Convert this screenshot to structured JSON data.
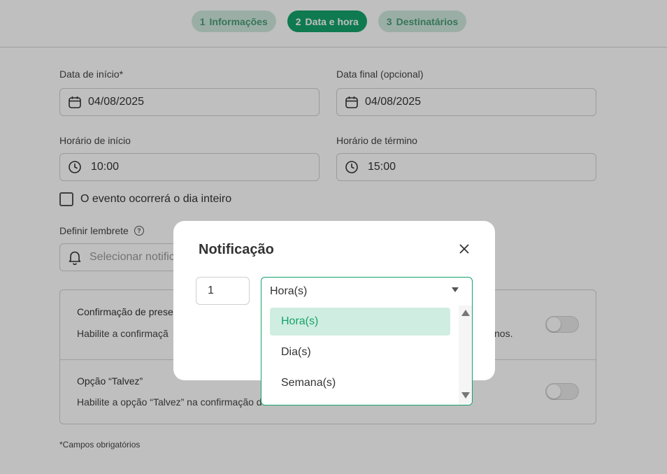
{
  "steps": [
    {
      "num": "1",
      "label": "Informações"
    },
    {
      "num": "2",
      "label": "Data e hora"
    },
    {
      "num": "3",
      "label": "Destinatários"
    }
  ],
  "form": {
    "start_date": {
      "label": "Data de início*",
      "value": "04/08/2025",
      "icon": "calendar-icon"
    },
    "end_date": {
      "label": "Data final (opcional)",
      "value": "04/08/2025",
      "icon": "calendar-icon"
    },
    "start_time": {
      "label": "Horário de início",
      "value": "10:00",
      "icon": "clock-icon"
    },
    "end_time": {
      "label": "Horário de término",
      "value": "15:00",
      "icon": "clock-icon"
    },
    "all_day": {
      "label": "O evento ocorrerá o dia inteiro",
      "checked": false
    },
    "reminder": {
      "label": "Definir lembrete",
      "placeholder": "Selecionar notific",
      "icon": "bell-icon"
    }
  },
  "options_card": {
    "confirmation": {
      "title": "Confirmação de prese",
      "description": "Habilite a confirmaçã",
      "description_tail": "nos.",
      "enabled": false
    },
    "maybe": {
      "title": "Opção “Talvez”",
      "description": "Habilite a opção “Talvez” na confirmação d",
      "enabled": false
    }
  },
  "footnote": "*Campos obrigatórios",
  "modal": {
    "title": "Notificação",
    "quantity": "1",
    "unit_selected": "Hora(s)",
    "unit_options": [
      "Hora(s)",
      "Dia(s)",
      "Semana(s)"
    ]
  },
  "colors": {
    "accent": "#14a36b",
    "accent_light": "#d0ede1",
    "step_inactive_bg": "#cfe8dc",
    "step_inactive_text": "#4a9d78"
  }
}
